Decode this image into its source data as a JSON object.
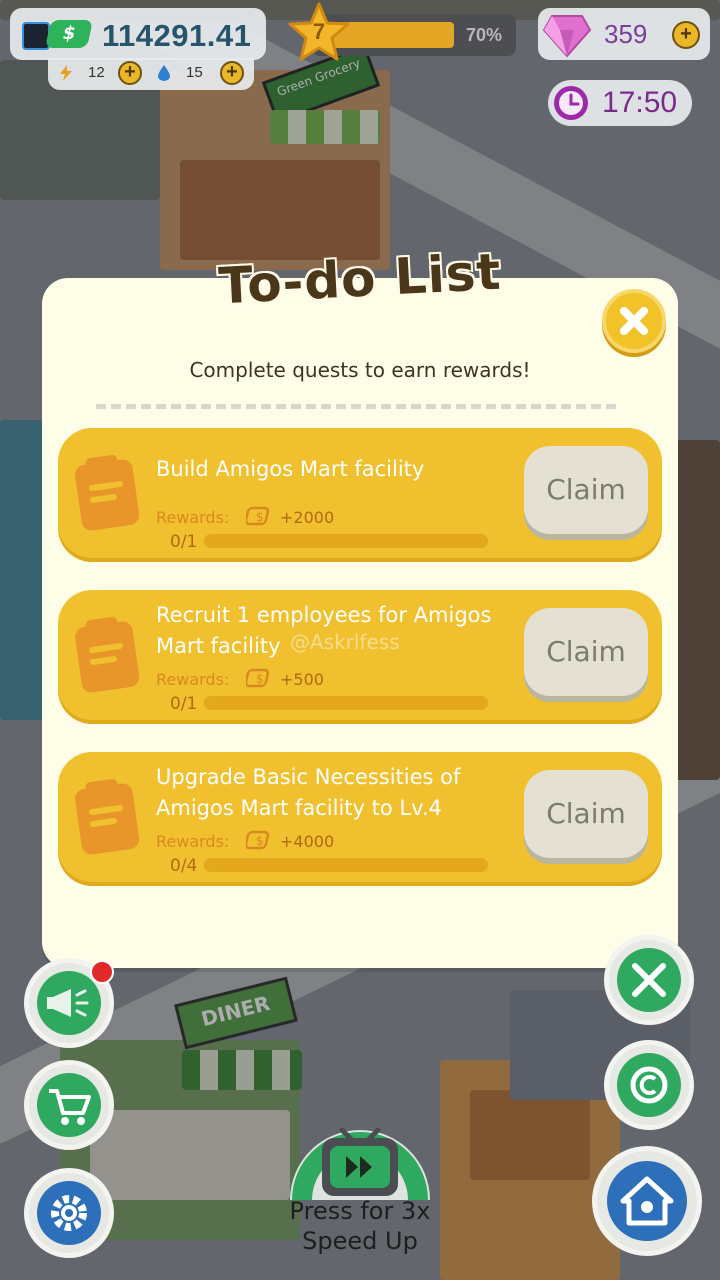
{
  "hud": {
    "cash": "114291.41",
    "energy": "12",
    "water": "15",
    "level": "7",
    "level_progress": "70%",
    "level_progress_value": 0.7,
    "gems": "359",
    "timer": "17:50"
  },
  "modal": {
    "title": "To-do List",
    "subtitle": "Complete quests to earn rewards!",
    "quests": [
      {
        "title": "Build Amigos Mart facility",
        "rewards_label": "Rewards:",
        "reward": "+2000",
        "progress": "0/1",
        "progress_value": 0,
        "claim": "Claim"
      },
      {
        "title": "Recruit 1 employees for Amigos Mart facility",
        "rewards_label": "Rewards:",
        "reward": "+500",
        "progress": "0/1",
        "progress_value": 0,
        "claim": "Claim"
      },
      {
        "title": "Upgrade Basic Necessities of Amigos Mart facility to Lv.4",
        "rewards_label": "Rewards:",
        "reward": "+4000",
        "progress": "0/4",
        "progress_value": 0,
        "claim": "Claim"
      }
    ]
  },
  "watermark": "@Askrlfess",
  "speed_up": {
    "line1": "Press for 3x",
    "line2": "Speed Up"
  },
  "background_signs": {
    "grocery": "Green Grocery",
    "diner": "DINER"
  },
  "colors": {
    "quest_card": "#f0c02e",
    "modal_bg": "#fdfde8",
    "claim_button": "#e4e1d2",
    "accent_green": "#2fb35a"
  }
}
